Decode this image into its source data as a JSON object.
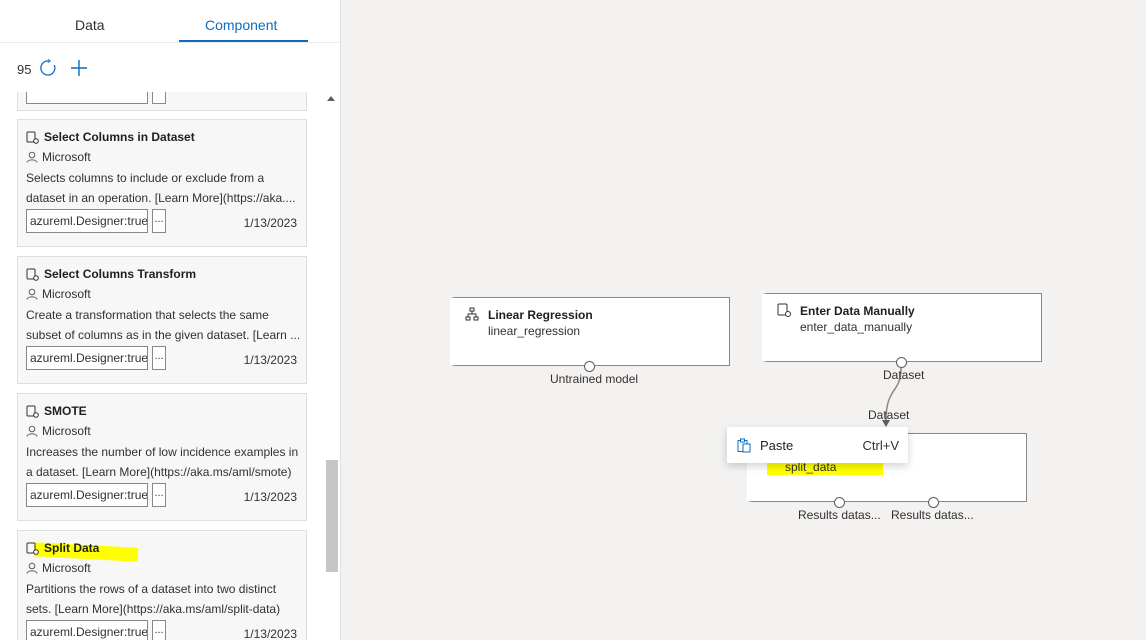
{
  "tabs": {
    "data": "Data",
    "component": "Component"
  },
  "toolbar": {
    "count": "95"
  },
  "cards": [
    {
      "title": "Select Columns in Dataset",
      "author": "Microsoft",
      "desc_line1": "Selects columns to include or exclude from a",
      "desc_line2": "dataset in an operation. [Learn More](https://aka....",
      "tag": "azureml.Designer:true",
      "more": "...",
      "date": "1/13/2023"
    },
    {
      "title": "Select Columns Transform",
      "author": "Microsoft",
      "desc_line1": "Create a transformation that selects the same",
      "desc_line2": "subset of columns as in the given dataset. [Learn ...",
      "tag": "azureml.Designer:true",
      "more": "...",
      "date": "1/13/2023"
    },
    {
      "title": "SMOTE",
      "author": "Microsoft",
      "desc_line1": "Increases the number of low incidence examples in",
      "desc_line2": "a dataset. [Learn More](https://aka.ms/aml/smote)",
      "tag": "azureml.Designer:true",
      "more": "...",
      "date": "1/13/2023"
    },
    {
      "title": "Split Data",
      "author": "Microsoft",
      "desc_line1": "Partitions the rows of a dataset into two distinct",
      "desc_line2": "sets. [Learn More](https://aka.ms/aml/split-data)",
      "tag": "azureml.Designer:true",
      "more": "...",
      "date": "1/13/2023"
    }
  ],
  "nodes": {
    "linear_regression": {
      "title": "Linear Regression",
      "sub": "linear_regression",
      "port_label": "Untrained model"
    },
    "enter_data": {
      "title": "Enter Data Manually",
      "sub": "enter_data_manually",
      "port_label": "Dataset"
    },
    "split_data": {
      "sub": "split_data",
      "in_label": "Dataset",
      "out1_label": "Results datas...",
      "out2_label": "Results datas..."
    }
  },
  "context_menu": {
    "label": "Paste",
    "shortcut": "Ctrl+V"
  },
  "colors": {
    "accent": "#0f6cbd",
    "highlight": "#ffff00"
  },
  "icons": [
    "refresh-icon",
    "add-icon",
    "component-icon",
    "person-icon",
    "tree-icon",
    "clipboard-icon"
  ]
}
